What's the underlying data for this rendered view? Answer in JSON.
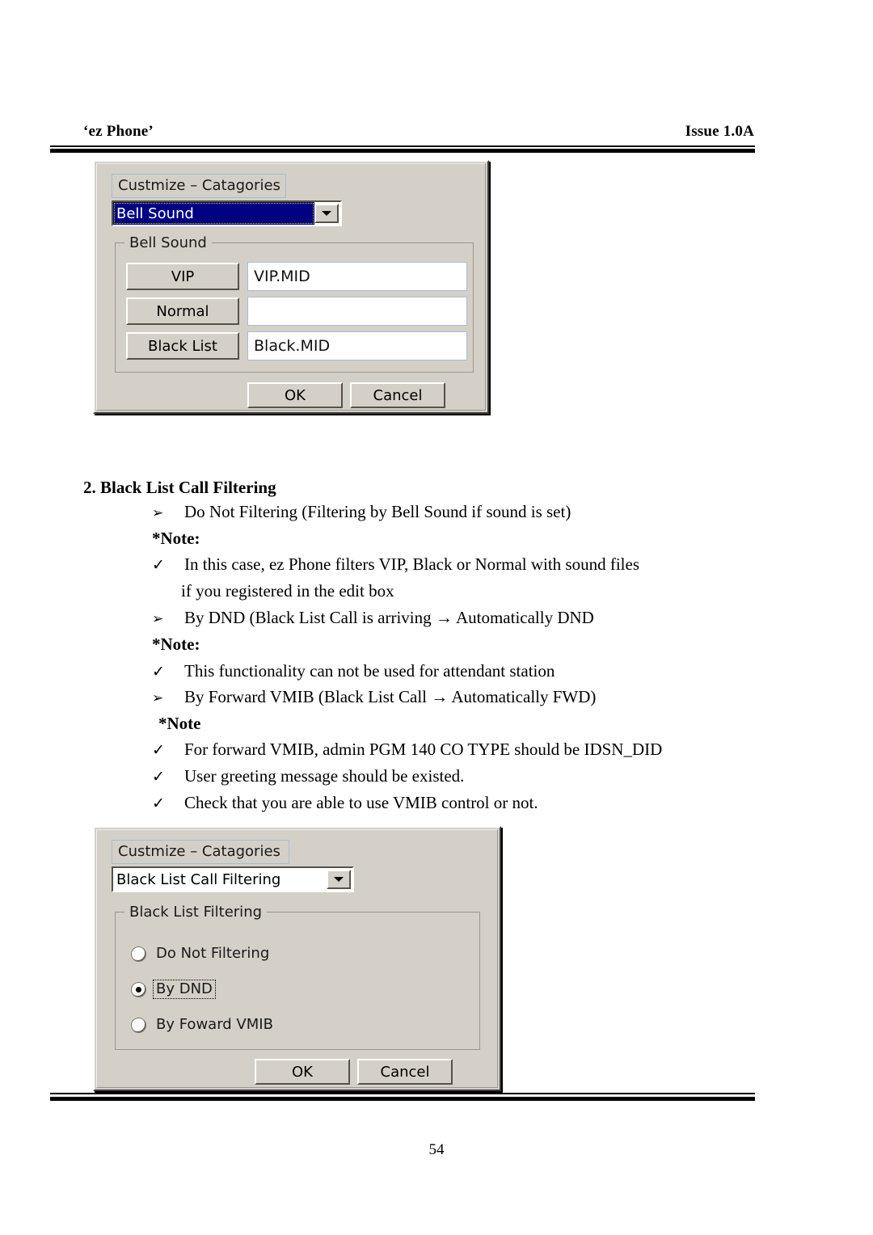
{
  "header": {
    "left": "‘ez Phone’",
    "right": "Issue 1.0A"
  },
  "footer": {
    "page_number": "54"
  },
  "dialog_bell_sound": {
    "category_label": "Custmize – Catagories",
    "category_combo_value": "Bell Sound",
    "category_combo_selected": true,
    "group_title": "Bell Sound",
    "rows": [
      {
        "button": "VIP",
        "value": "VIP.MID"
      },
      {
        "button": "Normal",
        "value": ""
      },
      {
        "button": "Black List",
        "value": "Black.MID"
      }
    ],
    "ok_label": "OK",
    "cancel_label": "Cancel"
  },
  "body": {
    "heading": "2. Black List Call Filtering",
    "lines": [
      {
        "marker": "➢",
        "text": "Do Not Filtering (Filtering by Bell Sound if sound is set)"
      },
      {
        "marker": "",
        "text": "*Note:"
      },
      {
        "marker": "✓",
        "text": "In this case, ez Phone filters VIP, Black or Normal with sound files"
      },
      {
        "marker": "",
        "text": "if you registered in the edit box"
      },
      {
        "marker": "➢",
        "text": "By DND (Black List Call is arriving → Automatically DND"
      },
      {
        "marker": "",
        "text": "*Note:"
      },
      {
        "marker": "✓",
        "text": "This functionality can not be used for attendant station"
      },
      {
        "marker": "➢",
        "text": "By Forward VMIB (Black List Call    → Automatically FWD)"
      },
      {
        "marker": "",
        "text": "*Note"
      },
      {
        "marker": "✓",
        "text": "For forward VMIB, admin PGM 140 CO TYPE should be IDSN_DID"
      },
      {
        "marker": "✓",
        "text": "User greeting message should be existed."
      },
      {
        "marker": "✓",
        "text": "Check that you are able to use VMIB control or not."
      }
    ]
  },
  "dialog_black_list": {
    "category_label": "Custmize – Catagories",
    "category_combo_value": "Black List Call Filtering",
    "category_combo_selected": false,
    "group_title": "Black List Filtering",
    "options": [
      {
        "label": "Do Not Filtering",
        "checked": false,
        "focused": false
      },
      {
        "label": "By DND",
        "checked": true,
        "focused": true
      },
      {
        "label": "By Foward VMIB",
        "checked": false,
        "focused": false
      }
    ],
    "ok_label": "OK",
    "cancel_label": "Cancel"
  },
  "colors": {
    "dialog_face": "#d4d0c8",
    "selection_blue": "#000080",
    "label_border": "#a8bcd4",
    "edit_border": "#a8bcd4"
  }
}
